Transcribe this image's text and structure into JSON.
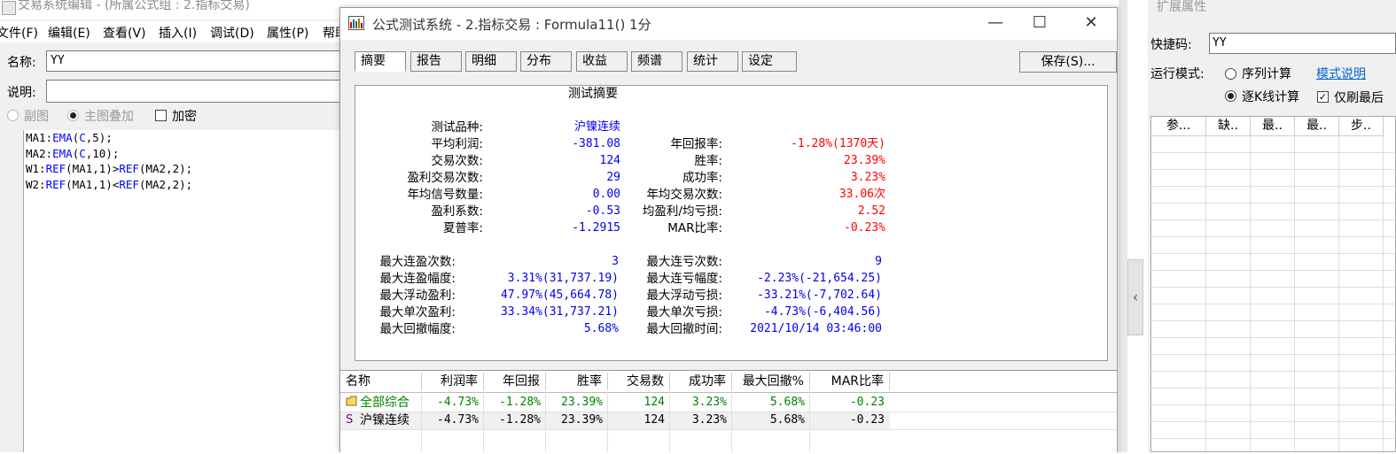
{
  "editor": {
    "title": "交易系统编辑 - (所属公式组 : 2.指标交易)",
    "menu": [
      "文件(F)",
      "编辑(E)",
      "查看(V)",
      "插入(I)",
      "调试(D)",
      "属性(P)",
      "帮助"
    ],
    "name_label": "名称:",
    "name_value": "YY",
    "desc_label": "说明:",
    "desc_value": "",
    "radio_sub": "副图",
    "radio_main": "主图叠加",
    "encrypt_label": "加密",
    "code": [
      [
        {
          "t": "MA1:",
          "k": false
        },
        {
          "t": "EMA",
          "k": true
        },
        {
          "t": "(",
          "k": false
        },
        {
          "t": "C",
          "k": true
        },
        {
          "t": ",5);",
          "k": false
        }
      ],
      [
        {
          "t": "MA2:",
          "k": false
        },
        {
          "t": "EMA",
          "k": true
        },
        {
          "t": "(",
          "k": false
        },
        {
          "t": "C",
          "k": true
        },
        {
          "t": ",10);",
          "k": false
        }
      ],
      [
        {
          "t": "W1:",
          "k": false
        },
        {
          "t": "REF",
          "k": true
        },
        {
          "t": "(MA1,1)>",
          "k": false
        },
        {
          "t": "REF",
          "k": true
        },
        {
          "t": "(MA2,2);",
          "k": false
        }
      ],
      [
        {
          "t": "W2:",
          "k": false
        },
        {
          "t": "REF",
          "k": true
        },
        {
          "t": "(MA1,1)<",
          "k": false
        },
        {
          "t": "REF",
          "k": true
        },
        {
          "t": "(MA2,2);",
          "k": false
        }
      ]
    ]
  },
  "dialog": {
    "title": "公式测试系统 - 2.指标交易 : Formula11() 1分",
    "minimize": "—",
    "maximize": "☐",
    "close": "✕",
    "tabs": [
      "摘要",
      "报告",
      "明细",
      "分布",
      "收益",
      "频谱",
      "统计",
      "设定"
    ],
    "save_label": "保存(S)...",
    "summary_title": "测试摘要",
    "left_col": [
      {
        "label": "测试品种:",
        "value": "沪镍连续"
      },
      {
        "label": "平均利润:",
        "value": "-381.08"
      },
      {
        "label": "交易次数:",
        "value": "124"
      },
      {
        "label": "盈利交易次数:",
        "value": "29"
      },
      {
        "label": "年均信号数量:",
        "value": "0.00"
      },
      {
        "label": "盈利系数:",
        "value": "-0.53"
      },
      {
        "label": "夏普率:",
        "value": "-1.2915"
      }
    ],
    "right_col": [
      {
        "label": "年回报率:",
        "value": "-1.28%(1370天)"
      },
      {
        "label": "胜率:",
        "value": "23.39%"
      },
      {
        "label": "成功率:",
        "value": "3.23%"
      },
      {
        "label": "年均交易次数:",
        "value": "33.06次"
      },
      {
        "label": "均盈利/均亏损:",
        "value": "2.52"
      },
      {
        "label": "MAR比率:",
        "value": "-0.23%"
      }
    ],
    "left_col2": [
      {
        "label": "最大连盈次数:",
        "value": "3"
      },
      {
        "label": "最大连盈幅度:",
        "value": "3.31%(31,737.19)"
      },
      {
        "label": "最大浮动盈利:",
        "value": "47.97%(45,664.78)"
      },
      {
        "label": "最大单次盈利:",
        "value": "33.34%(31,737.21)"
      },
      {
        "label": "最大回撤幅度:",
        "value": "5.68%"
      }
    ],
    "right_col2": [
      {
        "label": "最大连亏次数:",
        "value": "9"
      },
      {
        "label": "最大连亏幅度:",
        "value": "-2.23%(-21,654.25)"
      },
      {
        "label": "最大浮动亏损:",
        "value": "-33.21%(-7,702.64)"
      },
      {
        "label": "最大单次亏损:",
        "value": "-4.73%(-6,404.56)"
      },
      {
        "label": "最大回撤时间:",
        "value": "2021/10/14 03:46:00"
      }
    ],
    "table": {
      "headers": [
        "名称",
        "利润率",
        "年回报",
        "胜率",
        "交易数",
        "成功率",
        "最大回撤%",
        "MAR比率"
      ],
      "rows": [
        {
          "icon": "folder-icon",
          "cells": [
            "全部综合",
            "-4.73%",
            "-1.28%",
            "23.39%",
            "124",
            "3.23%",
            "5.68%",
            "-0.23"
          ]
        },
        {
          "icon": "S",
          "cells": [
            "沪镍连续",
            "-4.73%",
            "-1.28%",
            "23.39%",
            "124",
            "3.23%",
            "5.68%",
            "-0.23"
          ]
        }
      ]
    }
  },
  "right_panel": {
    "title": "扩展属性",
    "shortcut_label": "快捷码:",
    "shortcut_value": "YY",
    "mode_label": "运行模式:",
    "mode_seq": "序列计算",
    "mode_link": "模式说明",
    "mode_bar": "逐K线计算",
    "refresh_label": "仅刷最后",
    "grid_headers": [
      "参...",
      "缺..",
      "最..",
      "最..",
      "步.."
    ],
    "collapse_icon": "‹"
  }
}
